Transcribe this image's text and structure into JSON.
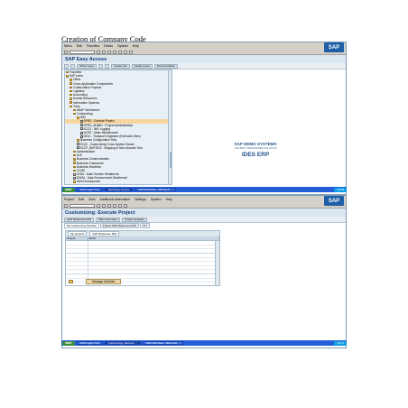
{
  "document": {
    "title": "Creation of Company Code"
  },
  "window1": {
    "menu": [
      "Menu",
      "Edit",
      "Favorites",
      "Extras",
      "System",
      "Help"
    ],
    "title": "SAP Easy Access",
    "app_toolbar": [
      "Other menu",
      "Create role",
      "Assign users",
      "Documentation"
    ],
    "tree": [
      {
        "label": "Favorites",
        "level": 0,
        "kind": "folder"
      },
      {
        "label": "SAP menu",
        "level": 0,
        "kind": "folder"
      },
      {
        "label": "Office",
        "level": 1,
        "kind": "folder"
      },
      {
        "label": "Cross-Application Components",
        "level": 1,
        "kind": "folder"
      },
      {
        "label": "Collaboration Projects",
        "level": 1,
        "kind": "folder"
      },
      {
        "label": "Logistics",
        "level": 1,
        "kind": "folder"
      },
      {
        "label": "Accounting",
        "level": 1,
        "kind": "folder"
      },
      {
        "label": "Human Resources",
        "level": 1,
        "kind": "folder"
      },
      {
        "label": "Information Systems",
        "level": 1,
        "kind": "folder"
      },
      {
        "label": "Tools",
        "level": 1,
        "kind": "folder"
      },
      {
        "label": "ABAP Workbench",
        "level": 2,
        "kind": "folder"
      },
      {
        "label": "Customizing",
        "level": 2,
        "kind": "folder"
      },
      {
        "label": "IMG",
        "level": 3,
        "kind": "folder"
      },
      {
        "label": "SPRO - Execute Project",
        "level": 4,
        "kind": "doc",
        "selected": true
      },
      {
        "label": "SPRO_ADMIN - Project Administration",
        "level": 4,
        "kind": "doc"
      },
      {
        "label": "SCC3 - IMG Logging",
        "level": 4,
        "kind": "doc"
      },
      {
        "label": "SCPR - Mass Maintenance",
        "level": 4,
        "kind": "doc"
      },
      {
        "label": "SE10 - Transport Organizer (Extended View)",
        "level": 4,
        "kind": "doc"
      },
      {
        "label": "Business Configuration Sets",
        "level": 3,
        "kind": "folder"
      },
      {
        "label": "SCU0 - Customizing Cross-System Viewer",
        "level": 3,
        "kind": "doc"
      },
      {
        "label": "SCCP_BMTRUS - Mapping of Non-Unicode Srvs",
        "level": 3,
        "kind": "doc"
      },
      {
        "label": "Administration",
        "level": 2,
        "kind": "folder"
      },
      {
        "label": "ALE",
        "level": 2,
        "kind": "folder"
      },
      {
        "label": "Business Communication",
        "level": 2,
        "kind": "folder"
      },
      {
        "label": "Business Framework",
        "level": 2,
        "kind": "folder"
      },
      {
        "label": "Business Workflow",
        "level": 2,
        "kind": "folder"
      },
      {
        "label": "CCMS",
        "level": 2,
        "kind": "folder"
      },
      {
        "label": "SXDA - Data Transfer Workbench",
        "level": 2,
        "kind": "doc"
      },
      {
        "label": "SDHM - Data Enhancement Workbench",
        "level": 2,
        "kind": "doc"
      },
      {
        "label": "Web Development",
        "level": 2,
        "kind": "folder"
      }
    ],
    "branding": {
      "line1": "SAP DEMO SYSTEMS",
      "line2": "THE BEST PERFORMER SOLUTION",
      "line3": "IDES ERP"
    },
    "taskbar": {
      "start": "start",
      "tasks": [
        "SAP Logon 710",
        "SAP Easy Access",
        "SAP R/3 basis - Microsoft ..."
      ],
      "clock": "10:38"
    }
  },
  "window2": {
    "menu": [
      "Project",
      "Edit",
      "Goto",
      "Additional information",
      "Settings",
      "System",
      "Help"
    ],
    "title": "Customizing: Execute Project",
    "app_toolbar": [
      "SAP Reference IMG",
      "IMG information",
      "Project Analysis"
    ],
    "tabs": [
      "My Customizing Worklist",
      "Project SAP Reference IMG",
      "FTI"
    ],
    "table": {
      "header_buttons": [
        "My projects",
        "SAP Reference IMG"
      ],
      "columns": [
        "Project",
        "Name"
      ]
    },
    "bottom_button": "Manage Worklist",
    "taskbar": {
      "start": "start",
      "tasks": [
        "SAP Logon 710",
        "Customizing: Execute ...",
        "SAP R/3 basis - Microsoft ..."
      ],
      "clock": "10:41"
    }
  }
}
